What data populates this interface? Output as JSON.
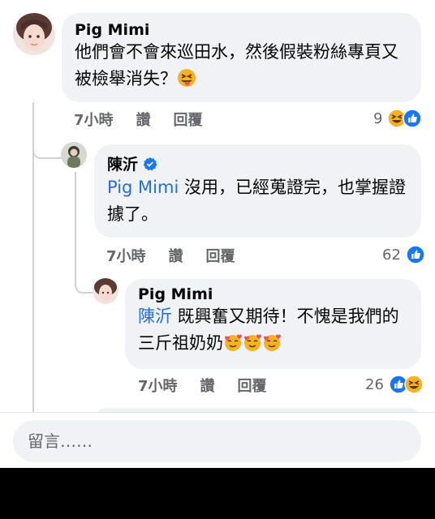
{
  "comments": [
    {
      "author": "Pig Mimi",
      "text": "他們會不會來巡田水，然後假裝粉絲專頁又被檢舉消失？",
      "emoji": "squinting-tongue",
      "time": "7小時",
      "like_label": "讚",
      "reply_label": "回覆",
      "reaction_count": "9",
      "reactions": [
        "haha",
        "like"
      ]
    },
    {
      "author": "陳沂",
      "verified": true,
      "mention": "Pig Mimi",
      "text": " 沒用，已經蒐證完，也掌握證據了。",
      "time": "7小時",
      "like_label": "讚",
      "reply_label": "回覆",
      "reaction_count": "62",
      "reactions": [
        "like"
      ]
    },
    {
      "author": "Pig Mimi",
      "mention": "陳沂",
      "text": " 既興奮又期待！不愧是我們的三斤祖奶奶",
      "emoji": "smiling-hearts",
      "emoji_count": 3,
      "time": "7小時",
      "like_label": "讚",
      "reply_label": "回覆",
      "reaction_count": "26",
      "reactions": [
        "like",
        "haha"
      ]
    }
  ],
  "composer": {
    "placeholder": "留言……"
  },
  "colors": {
    "like_blue": "#1877f2",
    "mention_blue": "#216fdb",
    "bubble_bg": "#f0f2f5",
    "haha_yellow": "#f7b125"
  }
}
